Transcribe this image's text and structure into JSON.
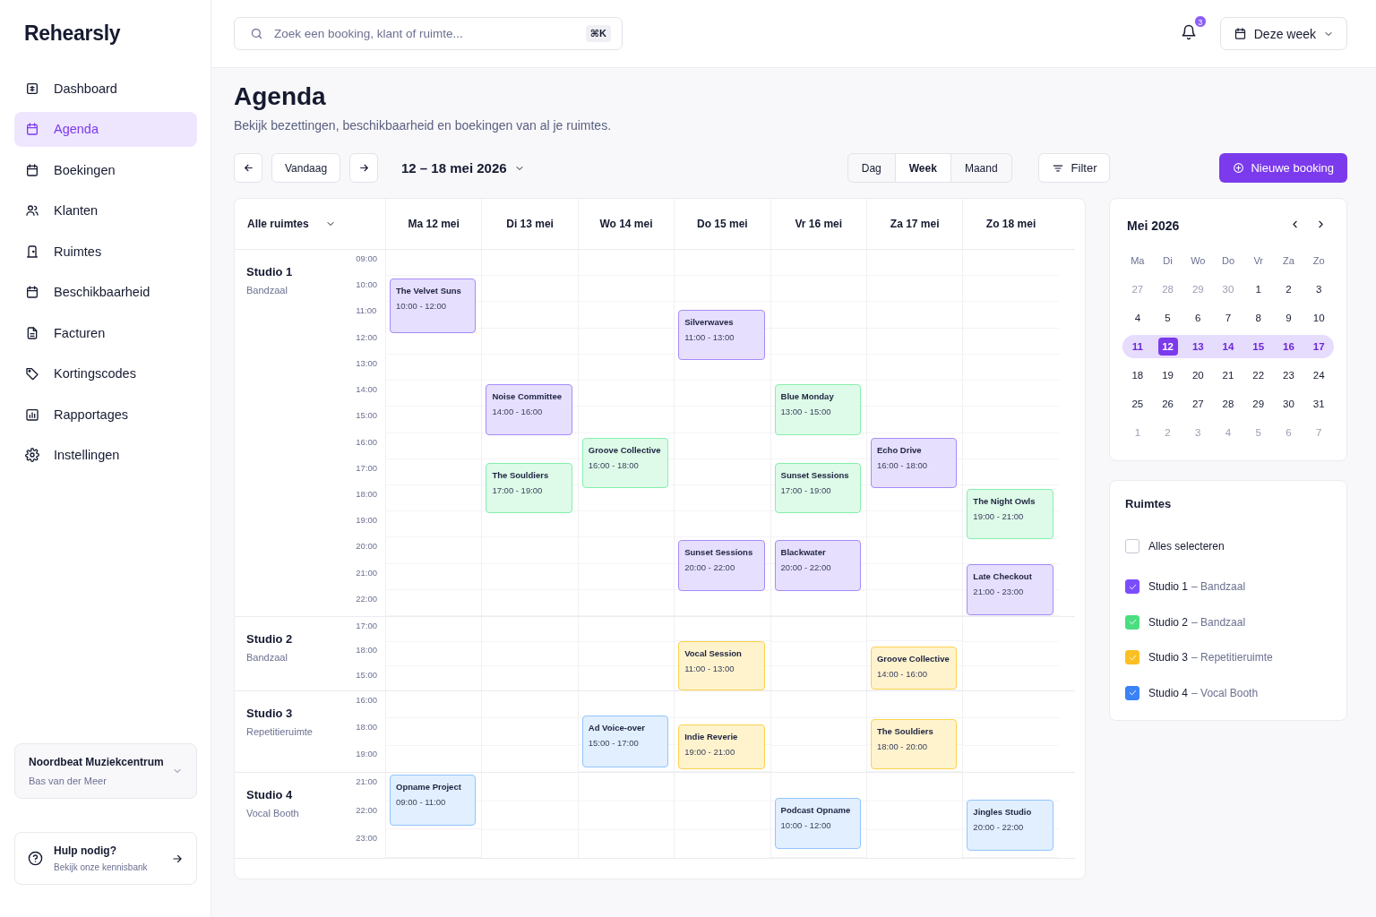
{
  "app": {
    "logo": "Rehearsly"
  },
  "sidebar": {
    "items": [
      {
        "label": "Dashboard",
        "selected": false
      },
      {
        "label": "Agenda",
        "selected": true
      },
      {
        "label": "Boekingen",
        "selected": false
      },
      {
        "label": "Klanten",
        "selected": false
      },
      {
        "label": "Ruimtes",
        "selected": false
      },
      {
        "label": "Beschikbaarheid",
        "selected": false
      },
      {
        "label": "Facturen",
        "selected": false
      },
      {
        "label": "Kortingscodes",
        "selected": false
      },
      {
        "label": "Rapportages",
        "selected": false
      },
      {
        "label": "Instellingen",
        "selected": false
      }
    ],
    "organization": {
      "name": "Noordbeat Muziekcentrum",
      "user": "Bas van der Meer"
    },
    "help": {
      "title": "Hulp nodig?",
      "subtitle": "Bekijk onze kennisbank"
    }
  },
  "topbar": {
    "search": {
      "placeholder": "Zoek een booking, klant of ruimte...",
      "shortcut": "⌘K"
    },
    "notifications": "3",
    "period": "Deze week"
  },
  "page": {
    "title": "Agenda",
    "subtitle": "Bekijk bezettingen, beschikbaarheid en boekingen van al je ruimtes."
  },
  "toolbar": {
    "today": "Vandaag",
    "range": "12 – 18 mei 2026",
    "views": [
      {
        "label": "Dag",
        "selected": false
      },
      {
        "label": "Week",
        "selected": true
      },
      {
        "label": "Maand",
        "selected": false
      }
    ],
    "filter": "Filter",
    "new_booking": "Nieuwe booking"
  },
  "calendar": {
    "room_filter": "Alle ruimtes",
    "days": [
      "Ma 12 mei",
      "Di 13 mei",
      "Wo 14 mei",
      "Do 15 mei",
      "Vr 16 mei",
      "Za 17 mei",
      "Zo 18 mei"
    ],
    "studios": [
      {
        "name": "Studio 1",
        "type": "Bandzaal",
        "hours": [
          "09:00",
          "10:00",
          "11:00",
          "12:00",
          "13:00",
          "14:00",
          "15:00",
          "16:00",
          "17:00",
          "18:00",
          "19:00",
          "20:00",
          "21:00",
          "22:00"
        ],
        "bookings": [
          {
            "title": "The Velvet Suns",
            "time": "10:00 - 12:00",
            "color": "#a78bfa"
          },
          {
            "title": "Noise Committee",
            "time": "14:00 - 16:00",
            "color": "#a78bfa"
          },
          {
            "title": "The Souldiers",
            "time": "17:00 - 19:00",
            "color": "#86efac"
          },
          {
            "title": "Groove Collective",
            "time": "16:00 - 18:00",
            "color": "#86efac"
          },
          {
            "title": "Silverwaves",
            "time": "11:00 - 13:00",
            "color": "#a78bfa"
          },
          {
            "title": "Sunset Sessions",
            "time": "20:00 - 22:00",
            "color": "#a78bfa"
          },
          {
            "title": "Blue Monday",
            "time": "13:00 - 15:00",
            "color": "#86efac"
          },
          {
            "title": "Sunset Sessions",
            "time": "17:00 - 19:00",
            "color": "#86efac"
          },
          {
            "title": "Blackwater",
            "time": "20:00 - 22:00",
            "color": "#a78bfa"
          },
          {
            "title": "Echo Drive",
            "time": "16:00 - 18:00",
            "color": "#a78bfa"
          },
          {
            "title": "The Night Owls",
            "time": "19:00 - 21:00",
            "color": "#86efac"
          },
          {
            "title": "Late Checkout",
            "time": "21:00 - 23:00",
            "color": "#a78bfa"
          }
        ]
      },
      {
        "name": "Studio 2",
        "type": "Bandzaal",
        "hours": [
          "17:00",
          "18:00",
          "15:00"
        ],
        "bookings": [
          {
            "title": "Vocal Session",
            "time": "11:00 - 13:00",
            "color": "#fcd34d"
          },
          {
            "title": "Groove Collective",
            "time": "14:00 - 16:00",
            "color": "#fcd34d"
          }
        ]
      },
      {
        "name": "Studio 3",
        "type": "Repetitieruimte",
        "hours": [
          "16:00",
          "18:00",
          "19:00"
        ],
        "bookings": [
          {
            "title": "Ad Voice-over",
            "time": "15:00 - 17:00",
            "color": "#93c5fd"
          },
          {
            "title": "Indie Reverie",
            "time": "19:00 - 21:00",
            "color": "#fcd34d"
          },
          {
            "title": "The Souldiers",
            "time": "18:00 - 20:00",
            "color": "#fcd34d"
          }
        ]
      },
      {
        "name": "Studio 4",
        "type": "Vocal Booth",
        "hours": [
          "21:00",
          "22:00",
          "23:00"
        ],
        "bookings": [
          {
            "title": "Opname Project",
            "time": "09:00 - 11:00",
            "color": "#93c5fd"
          },
          {
            "title": "Podcast Opname",
            "time": "10:00 - 12:00",
            "color": "#93c5fd"
          },
          {
            "title": "Jingles Studio",
            "time": "20:00 - 22:00",
            "color": "#93c5fd"
          }
        ]
      }
    ]
  },
  "mini_calendar": {
    "title": "Mei 2026",
    "weekdays": [
      "Ma",
      "Di",
      "Wo",
      "Do",
      "Vr",
      "Za",
      "Zo"
    ],
    "weeks": [
      {
        "highlighted": false,
        "days": [
          {
            "label": "27",
            "muted": true,
            "selected": false
          },
          {
            "label": "28",
            "muted": true,
            "selected": false
          },
          {
            "label": "29",
            "muted": true,
            "selected": false
          },
          {
            "label": "30",
            "muted": true,
            "selected": false
          },
          {
            "label": "1",
            "muted": false,
            "selected": false
          },
          {
            "label": "2",
            "muted": false,
            "selected": false
          },
          {
            "label": "3",
            "muted": false,
            "selected": false
          }
        ]
      },
      {
        "highlighted": false,
        "days": [
          {
            "label": "4",
            "muted": false,
            "selected": false
          },
          {
            "label": "5",
            "muted": false,
            "selected": false
          },
          {
            "label": "6",
            "muted": false,
            "selected": false
          },
          {
            "label": "7",
            "muted": false,
            "selected": false
          },
          {
            "label": "8",
            "muted": false,
            "selected": false
          },
          {
            "label": "9",
            "muted": false,
            "selected": false
          },
          {
            "label": "10",
            "muted": false,
            "selected": false
          }
        ]
      },
      {
        "highlighted": true,
        "days": [
          {
            "label": "11",
            "muted": false,
            "selected": false
          },
          {
            "label": "12",
            "muted": false,
            "selected": true
          },
          {
            "label": "13",
            "muted": false,
            "selected": false
          },
          {
            "label": "14",
            "muted": false,
            "selected": false
          },
          {
            "label": "15",
            "muted": false,
            "selected": false
          },
          {
            "label": "16",
            "muted": false,
            "selected": false
          },
          {
            "label": "17",
            "muted": false,
            "selected": false
          }
        ]
      },
      {
        "highlighted": false,
        "days": [
          {
            "label": "18",
            "muted": false,
            "selected": false
          },
          {
            "label": "19",
            "muted": false,
            "selected": false
          },
          {
            "label": "20",
            "muted": false,
            "selected": false
          },
          {
            "label": "21",
            "muted": false,
            "selected": false
          },
          {
            "label": "22",
            "muted": false,
            "selected": false
          },
          {
            "label": "23",
            "muted": false,
            "selected": false
          },
          {
            "label": "24",
            "muted": false,
            "selected": false
          }
        ]
      },
      {
        "highlighted": false,
        "days": [
          {
            "label": "25",
            "muted": false,
            "selected": false
          },
          {
            "label": "26",
            "muted": false,
            "selected": false
          },
          {
            "label": "27",
            "muted": false,
            "selected": false
          },
          {
            "label": "28",
            "muted": false,
            "selected": false
          },
          {
            "label": "29",
            "muted": false,
            "selected": false
          },
          {
            "label": "30",
            "muted": false,
            "selected": false
          },
          {
            "label": "31",
            "muted": false,
            "selected": false
          }
        ]
      },
      {
        "highlighted": false,
        "days": [
          {
            "label": "1",
            "muted": true,
            "selected": false
          },
          {
            "label": "2",
            "muted": true,
            "selected": false
          },
          {
            "label": "3",
            "muted": true,
            "selected": false
          },
          {
            "label": "4",
            "muted": true,
            "selected": false
          },
          {
            "label": "5",
            "muted": true,
            "selected": false
          },
          {
            "label": "6",
            "muted": true,
            "selected": false
          },
          {
            "label": "7",
            "muted": true,
            "selected": false
          }
        ]
      }
    ]
  },
  "rooms": {
    "title": "Ruimtes",
    "select_all": {
      "label": "Alles selecteren",
      "checked": false
    },
    "items": [
      {
        "name": "Studio 1",
        "type": "– Bandzaal",
        "checked": true,
        "color": "#7c4dff"
      },
      {
        "name": "Studio 2",
        "type": "– Bandzaal",
        "checked": true,
        "color": "#4ade80"
      },
      {
        "name": "Studio 3",
        "type": "– Repetitieruimte",
        "checked": true,
        "color": "#fbbf24"
      },
      {
        "name": "Studio 4",
        "type": "– Vocal Booth",
        "checked": true,
        "color": "#3b82f6"
      }
    ]
  }
}
